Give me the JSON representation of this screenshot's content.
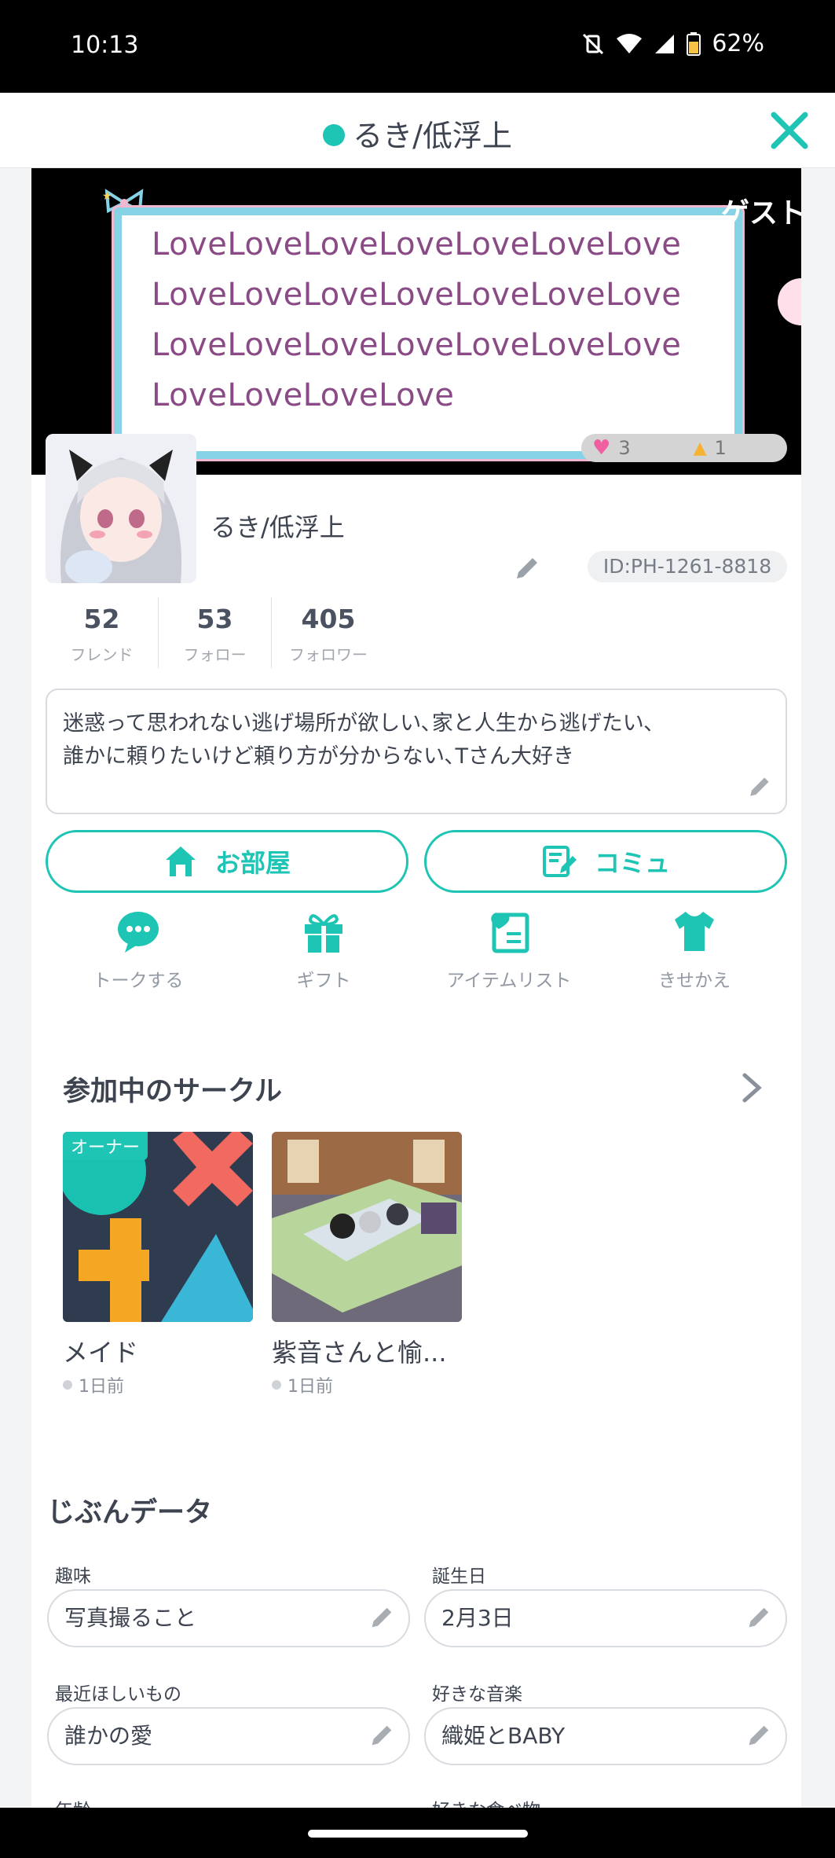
{
  "status_bar": {
    "time": "10:13",
    "battery": "62%"
  },
  "header": {
    "title": "るき/低浮上"
  },
  "banner": {
    "love_lines": [
      "LoveLoveLoveLoveLoveLoveLove",
      "LoveLoveLoveLoveLoveLoveLove",
      "LoveLoveLoveLoveLoveLoveLove",
      "LoveLoveLoveLove"
    ],
    "guest_label": "ゲスト",
    "likes_count": "3",
    "bells_count": "1"
  },
  "profile": {
    "name": "るき/低浮上",
    "id": "ID:PH-1261-8818",
    "stats": [
      {
        "value": "52",
        "label": "フレンド"
      },
      {
        "value": "53",
        "label": "フォロー"
      },
      {
        "value": "405",
        "label": "フォロワー"
      }
    ],
    "bio_lines": [
      "迷惑って思われない逃げ場所が欲しい､家と人生から逃げたい､",
      "誰かに頼りたいけど頼り方が分からない､Tさん大好き"
    ]
  },
  "buttons": {
    "room": "お部屋",
    "community": "コミュ"
  },
  "actions": [
    {
      "label": "トークする",
      "icon": "chat-bubble-icon"
    },
    {
      "label": "ギフト",
      "icon": "gift-icon"
    },
    {
      "label": "アイテムリスト",
      "icon": "heart-list-icon"
    },
    {
      "label": "きせかえ",
      "icon": "shirt-icon"
    }
  ],
  "circles": {
    "title": "参加中のサークル",
    "items": [
      {
        "name": "メイド",
        "date": "1日前",
        "badge": "オーナー"
      },
      {
        "name": "紫音さんと愉...",
        "date": "1日前"
      }
    ]
  },
  "self_data": {
    "title": "じぶんデータ",
    "fields": [
      {
        "label": "趣味",
        "value": "写真撮ること"
      },
      {
        "label": "誕生日",
        "value": "2月3日"
      },
      {
        "label": "最近ほしいもの",
        "value": "誰かの愛"
      },
      {
        "label": "好きな音楽",
        "value": "織姫とBABY"
      },
      {
        "label": "年齢",
        "value": ""
      },
      {
        "label": "好きな食べ物",
        "value": ""
      }
    ]
  },
  "colors": {
    "accent": "#1ec4b4",
    "text": "#3d4450",
    "love_text": "#8a4a86"
  }
}
